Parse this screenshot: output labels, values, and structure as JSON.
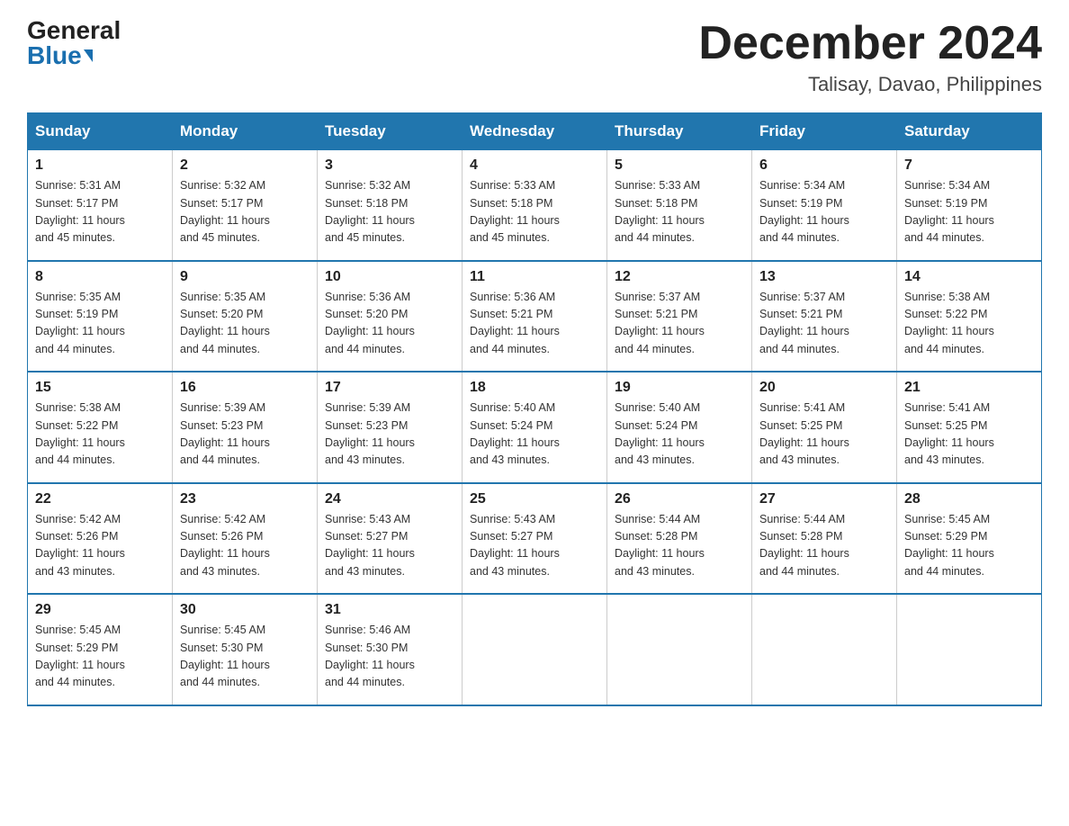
{
  "logo": {
    "general": "General",
    "blue": "Blue"
  },
  "title": {
    "month_year": "December 2024",
    "location": "Talisay, Davao, Philippines"
  },
  "weekdays": [
    "Sunday",
    "Monday",
    "Tuesday",
    "Wednesday",
    "Thursday",
    "Friday",
    "Saturday"
  ],
  "weeks": [
    [
      {
        "day": "1",
        "sunrise": "5:31 AM",
        "sunset": "5:17 PM",
        "daylight": "11 hours and 45 minutes."
      },
      {
        "day": "2",
        "sunrise": "5:32 AM",
        "sunset": "5:17 PM",
        "daylight": "11 hours and 45 minutes."
      },
      {
        "day": "3",
        "sunrise": "5:32 AM",
        "sunset": "5:18 PM",
        "daylight": "11 hours and 45 minutes."
      },
      {
        "day": "4",
        "sunrise": "5:33 AM",
        "sunset": "5:18 PM",
        "daylight": "11 hours and 45 minutes."
      },
      {
        "day": "5",
        "sunrise": "5:33 AM",
        "sunset": "5:18 PM",
        "daylight": "11 hours and 44 minutes."
      },
      {
        "day": "6",
        "sunrise": "5:34 AM",
        "sunset": "5:19 PM",
        "daylight": "11 hours and 44 minutes."
      },
      {
        "day": "7",
        "sunrise": "5:34 AM",
        "sunset": "5:19 PM",
        "daylight": "11 hours and 44 minutes."
      }
    ],
    [
      {
        "day": "8",
        "sunrise": "5:35 AM",
        "sunset": "5:19 PM",
        "daylight": "11 hours and 44 minutes."
      },
      {
        "day": "9",
        "sunrise": "5:35 AM",
        "sunset": "5:20 PM",
        "daylight": "11 hours and 44 minutes."
      },
      {
        "day": "10",
        "sunrise": "5:36 AM",
        "sunset": "5:20 PM",
        "daylight": "11 hours and 44 minutes."
      },
      {
        "day": "11",
        "sunrise": "5:36 AM",
        "sunset": "5:21 PM",
        "daylight": "11 hours and 44 minutes."
      },
      {
        "day": "12",
        "sunrise": "5:37 AM",
        "sunset": "5:21 PM",
        "daylight": "11 hours and 44 minutes."
      },
      {
        "day": "13",
        "sunrise": "5:37 AM",
        "sunset": "5:21 PM",
        "daylight": "11 hours and 44 minutes."
      },
      {
        "day": "14",
        "sunrise": "5:38 AM",
        "sunset": "5:22 PM",
        "daylight": "11 hours and 44 minutes."
      }
    ],
    [
      {
        "day": "15",
        "sunrise": "5:38 AM",
        "sunset": "5:22 PM",
        "daylight": "11 hours and 44 minutes."
      },
      {
        "day": "16",
        "sunrise": "5:39 AM",
        "sunset": "5:23 PM",
        "daylight": "11 hours and 44 minutes."
      },
      {
        "day": "17",
        "sunrise": "5:39 AM",
        "sunset": "5:23 PM",
        "daylight": "11 hours and 43 minutes."
      },
      {
        "day": "18",
        "sunrise": "5:40 AM",
        "sunset": "5:24 PM",
        "daylight": "11 hours and 43 minutes."
      },
      {
        "day": "19",
        "sunrise": "5:40 AM",
        "sunset": "5:24 PM",
        "daylight": "11 hours and 43 minutes."
      },
      {
        "day": "20",
        "sunrise": "5:41 AM",
        "sunset": "5:25 PM",
        "daylight": "11 hours and 43 minutes."
      },
      {
        "day": "21",
        "sunrise": "5:41 AM",
        "sunset": "5:25 PM",
        "daylight": "11 hours and 43 minutes."
      }
    ],
    [
      {
        "day": "22",
        "sunrise": "5:42 AM",
        "sunset": "5:26 PM",
        "daylight": "11 hours and 43 minutes."
      },
      {
        "day": "23",
        "sunrise": "5:42 AM",
        "sunset": "5:26 PM",
        "daylight": "11 hours and 43 minutes."
      },
      {
        "day": "24",
        "sunrise": "5:43 AM",
        "sunset": "5:27 PM",
        "daylight": "11 hours and 43 minutes."
      },
      {
        "day": "25",
        "sunrise": "5:43 AM",
        "sunset": "5:27 PM",
        "daylight": "11 hours and 43 minutes."
      },
      {
        "day": "26",
        "sunrise": "5:44 AM",
        "sunset": "5:28 PM",
        "daylight": "11 hours and 43 minutes."
      },
      {
        "day": "27",
        "sunrise": "5:44 AM",
        "sunset": "5:28 PM",
        "daylight": "11 hours and 44 minutes."
      },
      {
        "day": "28",
        "sunrise": "5:45 AM",
        "sunset": "5:29 PM",
        "daylight": "11 hours and 44 minutes."
      }
    ],
    [
      {
        "day": "29",
        "sunrise": "5:45 AM",
        "sunset": "5:29 PM",
        "daylight": "11 hours and 44 minutes."
      },
      {
        "day": "30",
        "sunrise": "5:45 AM",
        "sunset": "5:30 PM",
        "daylight": "11 hours and 44 minutes."
      },
      {
        "day": "31",
        "sunrise": "5:46 AM",
        "sunset": "5:30 PM",
        "daylight": "11 hours and 44 minutes."
      },
      null,
      null,
      null,
      null
    ]
  ],
  "labels": {
    "sunrise": "Sunrise:",
    "sunset": "Sunset:",
    "daylight": "Daylight:"
  }
}
